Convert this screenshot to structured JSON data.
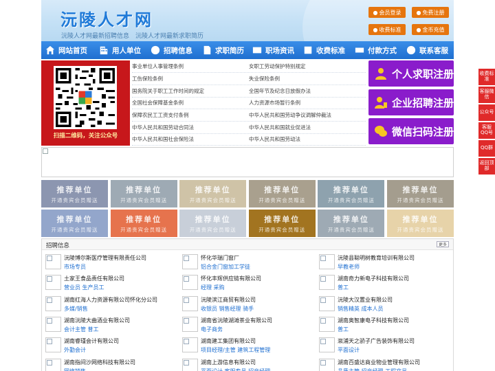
{
  "header": {
    "site_title": "沅陵人才网",
    "subtitle": "沅陵人才网最新招聘信息　沅陵人才网最新求职简历",
    "buttons": [
      {
        "label": "会员登录",
        "icon": "user-icon"
      },
      {
        "label": "免费注册",
        "icon": "register-icon"
      },
      {
        "label": "收费标准",
        "icon": "price-icon"
      },
      {
        "label": "金币充值",
        "icon": "coin-icon"
      }
    ]
  },
  "nav": [
    {
      "label": "网站首页",
      "icon": "home-icon"
    },
    {
      "label": "用人单位",
      "icon": "building-icon"
    },
    {
      "label": "招聘信息",
      "icon": "recruit-icon"
    },
    {
      "label": "求职简历",
      "icon": "resume-icon"
    },
    {
      "label": "职场资讯",
      "icon": "news-icon"
    },
    {
      "label": "收费标准",
      "icon": "fee-icon"
    },
    {
      "label": "付款方式",
      "icon": "payment-icon"
    },
    {
      "label": "联系客服",
      "icon": "service-icon"
    }
  ],
  "qr": {
    "caption": "扫描二维码，关注公众号"
  },
  "policy_links": [
    [
      "事业单位人事管理条例",
      "女职工劳动保护特别规定"
    ],
    [
      "工伤保险条例",
      "失业保险条例"
    ],
    [
      "国务院关于职工工作时间的规定",
      "全国年节及纪念日放假办法"
    ],
    [
      "全国社会保障基金条例",
      "人力资源市场暂行条例"
    ],
    [
      "保障农民工工资支付条例",
      "中华人民共和国劳动争议调解仲裁法"
    ],
    [
      "中华人民共和国劳动合同法",
      "中华人民共和国就业促进法"
    ],
    [
      "中华人民共和国社会保险法",
      "中华人民共和国劳动法"
    ]
  ],
  "register_buttons": [
    {
      "label": "个人求职注册",
      "icon": "person-icon"
    },
    {
      "label": "企业招聘注册",
      "icon": "company-icon"
    },
    {
      "label": "微信扫码注册",
      "icon": "wechat-icon"
    }
  ],
  "recommend": {
    "title": "推荐单位",
    "subtitle": "开通贵宾会员赠送",
    "colors": [
      "#8c96b0",
      "#9eaab4",
      "#cfc3a7",
      "#a9a08e",
      "#8ea2ae",
      "#a49d8e",
      "#93a6cb",
      "#e6734d",
      "#c8cfd9",
      "#a27420",
      "#9eaab4",
      "#e7d3a9"
    ]
  },
  "recruit": {
    "title": "招聘信息",
    "more": "更多",
    "jobs": [
      {
        "company": "沅陵博尔斯医疗管理有限责任公司",
        "positions": "市场专员"
      },
      {
        "company": "怀化华瑞门窗厂",
        "positions": "铝合金门窗加工学徒"
      },
      {
        "company": "沅陵县聪明树教育培训有限公司",
        "positions": "早教老师"
      },
      {
        "company": "土家王食品责任有限公司",
        "positions": "营业员 生产员工"
      },
      {
        "company": "怀化丰辉供应链有限公司",
        "positions": "经理 采购"
      },
      {
        "company": "湖南奇力新电子科技有限公司",
        "positions": "普工"
      },
      {
        "company": "湖南红海人力资源有限公司怀化分公司",
        "positions": "多媒/销售"
      },
      {
        "company": "沅陵滨江商贸有限公司",
        "positions": "收银员 销售经理 骑手"
      },
      {
        "company": "沅陵大汉置业有限公司",
        "positions": "销售精英 成本人员"
      },
      {
        "company": "湖南沅陵大曲酒业有限公司",
        "positions": "会计主管 普工"
      },
      {
        "company": "湖南省沅陵湖滩茶业有限公司",
        "positions": "电子商务"
      },
      {
        "company": "湖南奥智康电子科技有限公司",
        "positions": "普工"
      },
      {
        "company": "湖南睿瑾会计有限公司",
        "positions": "外勤会计"
      },
      {
        "company": "湖南建工集团有限公司",
        "positions": "项目经理/主管 建筑工程管理"
      },
      {
        "company": "溆浦天之骄子广告装饰有限公司",
        "positions": "平面设计"
      },
      {
        "company": "湖南指间沙网络科技有限公司",
        "positions": "网络销售"
      },
      {
        "company": "湖南上游信息有限公司",
        "positions": "平面设计 客服专员 招商经理"
      },
      {
        "company": "湖南百盛达商业物业管理有限公司",
        "positions": "品质主管 招商经理 工程文员"
      }
    ]
  },
  "float_bar": [
    "收费标准",
    "客服微信",
    "公众号",
    "客服QQ号",
    "QQ群",
    "返回顶部"
  ]
}
